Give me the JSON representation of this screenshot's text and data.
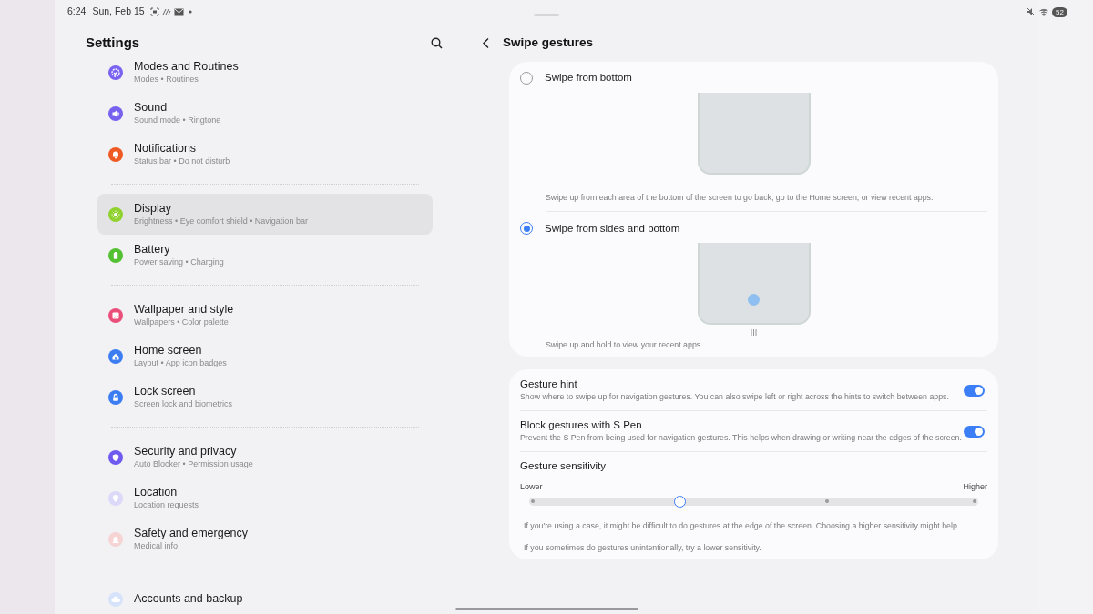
{
  "status_bar": {
    "time": "6:24",
    "date": "Sun, Feb 15",
    "battery": "52"
  },
  "settings": {
    "title": "Settings",
    "groups": [
      [
        {
          "title": "Modes and Routines",
          "subtitle": "Modes • Routines",
          "color": "#7a63f0",
          "selected": false
        },
        {
          "title": "Sound",
          "subtitle": "Sound mode • Ringtone",
          "color": "#7662ee",
          "selected": false
        },
        {
          "title": "Notifications",
          "subtitle": "Status bar • Do not disturb",
          "color": "#ee5a24",
          "selected": false
        }
      ],
      [
        {
          "title": "Display",
          "subtitle": "Brightness • Eye comfort shield • Navigation bar",
          "color": "#8fd12e",
          "selected": true
        },
        {
          "title": "Battery",
          "subtitle": "Power saving • Charging",
          "color": "#54c133",
          "selected": false
        }
      ],
      [
        {
          "title": "Wallpaper and style",
          "subtitle": "Wallpapers • Color palette",
          "color": "#ea4f7a",
          "selected": false
        },
        {
          "title": "Home screen",
          "subtitle": "Layout • App icon badges",
          "color": "#3c7ef2",
          "selected": false
        },
        {
          "title": "Lock screen",
          "subtitle": "Screen lock and biometrics",
          "color": "#3c7ef2",
          "selected": false
        }
      ],
      [
        {
          "title": "Security and privacy",
          "subtitle": "Auto Blocker • Permission usage",
          "color": "#6f5af0",
          "selected": false
        },
        {
          "title": "Location",
          "subtitle": "Location requests",
          "color": "#dcd8f8",
          "selected": false
        },
        {
          "title": "Safety and emergency",
          "subtitle": "Medical info",
          "color": "#f6d4d4",
          "selected": false
        }
      ],
      [
        {
          "title": "Accounts and backup",
          "color": "#d6e3fa",
          "selected": false
        }
      ]
    ]
  },
  "detail": {
    "title": "Swipe gestures",
    "options": [
      {
        "label": "Swipe from bottom",
        "selected": false,
        "kind": "bottom",
        "description": "Swipe up from each area of the bottom of the screen to go back, go to the Home screen, or view recent apps."
      },
      {
        "label": "Swipe from sides and bottom",
        "selected": true,
        "kind": "sides",
        "description": "Swipe up and hold to view your recent apps."
      }
    ],
    "toggles": [
      {
        "title": "Gesture hint",
        "description": "Show where to swipe up for navigation gestures. You can also swipe left or right across the hints to switch between apps.",
        "on": true
      },
      {
        "title": "Block gestures with S Pen",
        "description": "Prevent the S Pen from being used for navigation gestures. This helps when drawing or writing near the edges of the screen.",
        "on": true
      }
    ],
    "sensitivity": {
      "title": "Gesture sensitivity",
      "low_label": "Lower",
      "high_label": "Higher",
      "level": 0.333,
      "notes": [
        "If you're using a case, it might be difficult to do gestures at the edge of the screen. Choosing a higher sensitivity might help.",
        "If you sometimes do gestures unintentionally, try a lower sensitivity."
      ]
    }
  }
}
